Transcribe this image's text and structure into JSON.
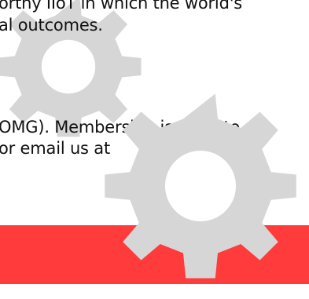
{
  "content": {
    "line_1": "orthy IIoT in which the world's",
    "line_2": "al outcomes.",
    "line_3": "OMG). Membership is open to",
    "line_4": "or email us at"
  },
  "decorations": {
    "gear_color": "#d6d6d6",
    "band_color": "#ff3b3b",
    "icons": [
      "gear-icon",
      "gear-icon"
    ]
  }
}
